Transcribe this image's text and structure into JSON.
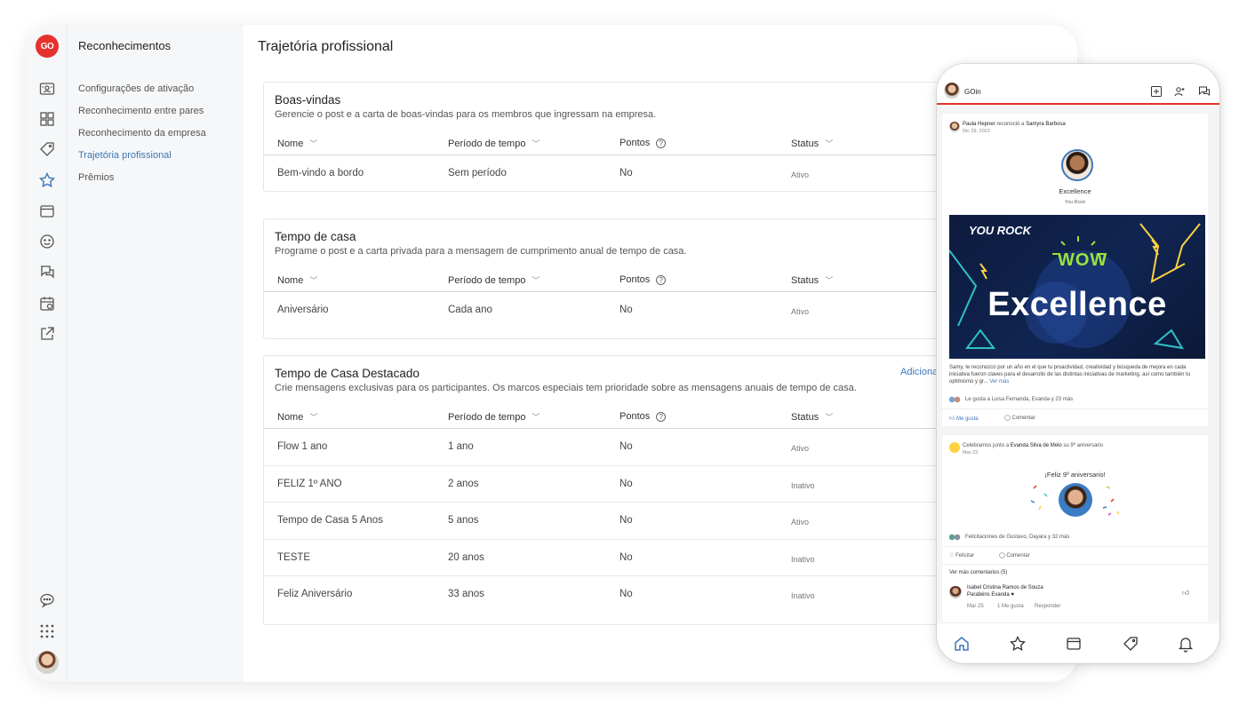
{
  "app": {
    "logo_text": "GO",
    "section_title": "Reconhecimentos",
    "page_title": "Trajetória profissional"
  },
  "rail_icons": [
    "badge-icon",
    "grid-icon",
    "tag-icon",
    "star-icon",
    "wallet-icon",
    "smile-icon",
    "chat-icon",
    "calendar-icon",
    "external-link-icon",
    "comment-dots-icon",
    "apps-grid-icon"
  ],
  "subnav": {
    "items": [
      {
        "label": "Configurações de ativação",
        "active": false
      },
      {
        "label": "Reconhecimento entre pares",
        "active": false
      },
      {
        "label": "Reconhecimento da empresa",
        "active": false
      },
      {
        "label": "Trajetória profissional",
        "active": true
      },
      {
        "label": "Prêmios",
        "active": false
      }
    ]
  },
  "columns": {
    "name": "Nome",
    "period": "Período de tempo",
    "points": "Pontos",
    "status": "Status"
  },
  "cards": [
    {
      "title": "Boas-vindas",
      "description": "Gerencie o post e a carta de boas-vindas para os membros que ingressam na empresa.",
      "rows": [
        {
          "name": "Bem-vindo a bordo",
          "period": "Sem período",
          "points": "No",
          "status": "Ativo"
        }
      ]
    },
    {
      "title": "Tempo de casa",
      "description": "Programe o post e a carta privada para a mensagem de cumprimento anual de tempo de casa.",
      "rows": [
        {
          "name": "Aniversário",
          "period": "Cada ano",
          "points": "No",
          "status": "Ativo"
        }
      ]
    },
    {
      "title": "Tempo de Casa Destacado",
      "description": "Crie mensagens exclusivas para os participantes. Os marcos especiais tem prioridade sobre as mensagens anuais de tempo de casa.",
      "action": "Adiciona",
      "rows": [
        {
          "name": "Flow 1 ano",
          "period": "1 ano",
          "points": "No",
          "status": "Ativo"
        },
        {
          "name": "FELIZ 1º ANO",
          "period": "2 anos",
          "points": "No",
          "status": "Inativo"
        },
        {
          "name": "Tempo de Casa 5 Anos",
          "period": "5 anos",
          "points": "No",
          "status": "Ativo"
        },
        {
          "name": "TESTE",
          "period": "20 anos",
          "points": "No",
          "status": "Inativo"
        },
        {
          "name": "Feliz Aniversário",
          "period": "33 anos",
          "points": "No",
          "status": "Inativo"
        }
      ]
    }
  ],
  "phone": {
    "brand": "GOin",
    "post1": {
      "author": "Paula Hepner",
      "verb": "reconoció a",
      "target": "Samyra Barbosa",
      "date": "Dic 29, 2022",
      "award": "Excellence",
      "award_sub": "You Rock",
      "banner_badge": "YOU ROCK",
      "banner_wow": "WOW",
      "banner_text": "Excellence",
      "body": "Samy, te reconozco por un año en el que tu proactividad, creatividad y búsqueda de mejora en cada iniciativa fueron claves para el desarrollo de las distintas iniciativas de marketing, así como también tu optimismo y gr...",
      "more": "Ver más",
      "likes": "Le gusta a Luisa Fernanda, Evanda y 23 más",
      "like_btn": "Me gusta",
      "comment_btn": "Comentar"
    },
    "post2": {
      "headline_prefix": "Celebramos junto a",
      "headline_name": "Evanda Silva de Melo",
      "headline_suffix": "su 9º aniversario",
      "date": "Mar 23",
      "greeting": "¡Feliz 9º aniversario!",
      "congrats": "Felicitaciones de Gustavo, Dayara y 32 más",
      "congrats_btn": "Felicitar",
      "comment_btn": "Comentar",
      "see_comments": "Ver más comentarios (5)",
      "commenter": "Isabel Cristina Ramos de Souza",
      "comment": "Parabéns Evanda ♥",
      "comment_date": "Mar 25",
      "comment_likes": "1 Me gusta",
      "reply": "Responder"
    }
  },
  "colors": {
    "brand_red": "#e5322d",
    "link_blue": "#3d78b8",
    "text_dark": "#222222"
  }
}
